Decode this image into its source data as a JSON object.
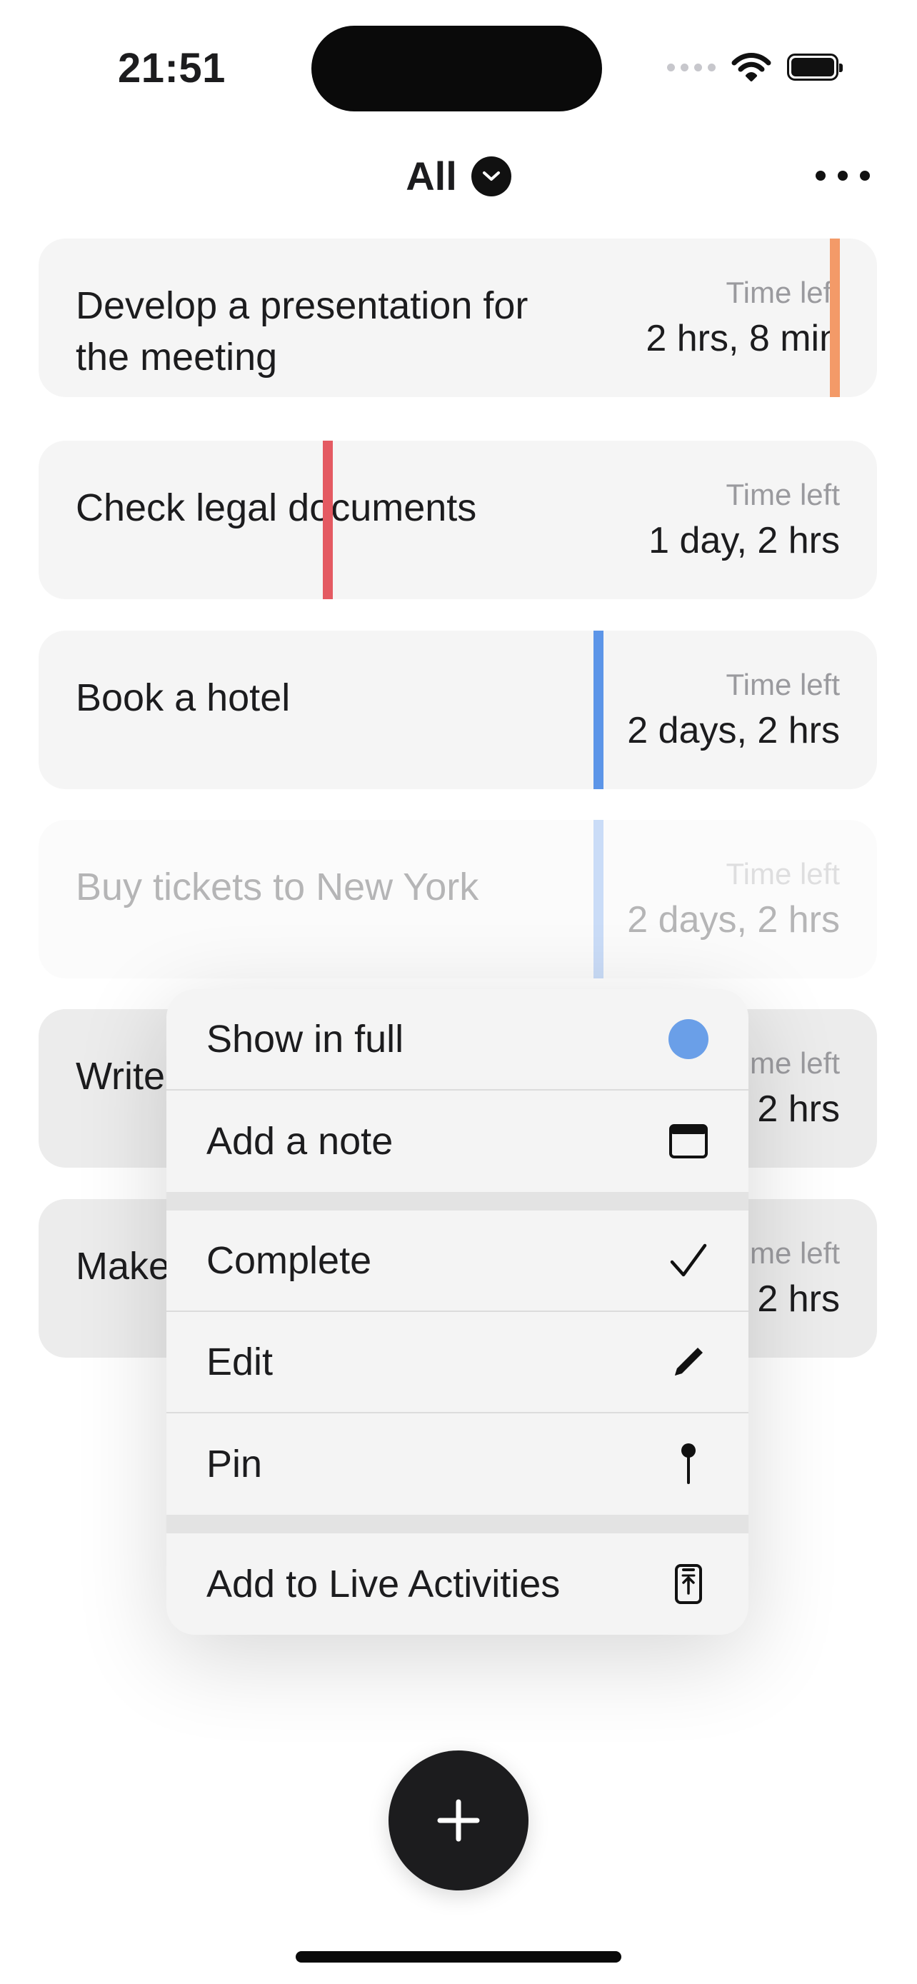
{
  "status_bar": {
    "time": "21:51"
  },
  "header": {
    "filter_label": "All",
    "filter_icon": "chevron-down-icon",
    "more_icon": "ellipsis-icon"
  },
  "tasks": [
    {
      "title": "Develop a presentation for the meeting",
      "time_left_label": "Time left",
      "time_left": "2 hrs, 8 min",
      "color": "#F39A68"
    },
    {
      "title": "Check legal documents",
      "time_left_label": "Time left",
      "time_left": "1 day, 2 hrs",
      "color": "#E45A62"
    },
    {
      "title": "Book a hotel",
      "time_left_label": "Time left",
      "time_left": "2 days, 2 hrs",
      "color": "#5C95E8"
    },
    {
      "title": "Buy tickets to New York",
      "time_left_label": "Time left",
      "time_left": "2 days, 2 hrs",
      "color": "#5C95E8"
    },
    {
      "title": "Write",
      "time_left_label": "me left",
      "time_left": "2 hrs"
    },
    {
      "title": "Make",
      "time_left_label": "me left",
      "time_left": "2 hrs"
    }
  ],
  "context_menu": {
    "items": [
      {
        "label": "Show in full",
        "icon": "blue-dot-icon"
      },
      {
        "label": "Add a note",
        "icon": "note-window-icon"
      },
      {
        "label": "Complete",
        "icon": "checkmark-icon"
      },
      {
        "label": "Edit",
        "icon": "pencil-icon"
      },
      {
        "label": "Pin",
        "icon": "pin-icon"
      },
      {
        "label": "Add to Live Activities",
        "icon": "live-activities-icon"
      }
    ],
    "accent_color": "#6A9FE8"
  },
  "fab": {
    "icon": "plus-icon"
  }
}
